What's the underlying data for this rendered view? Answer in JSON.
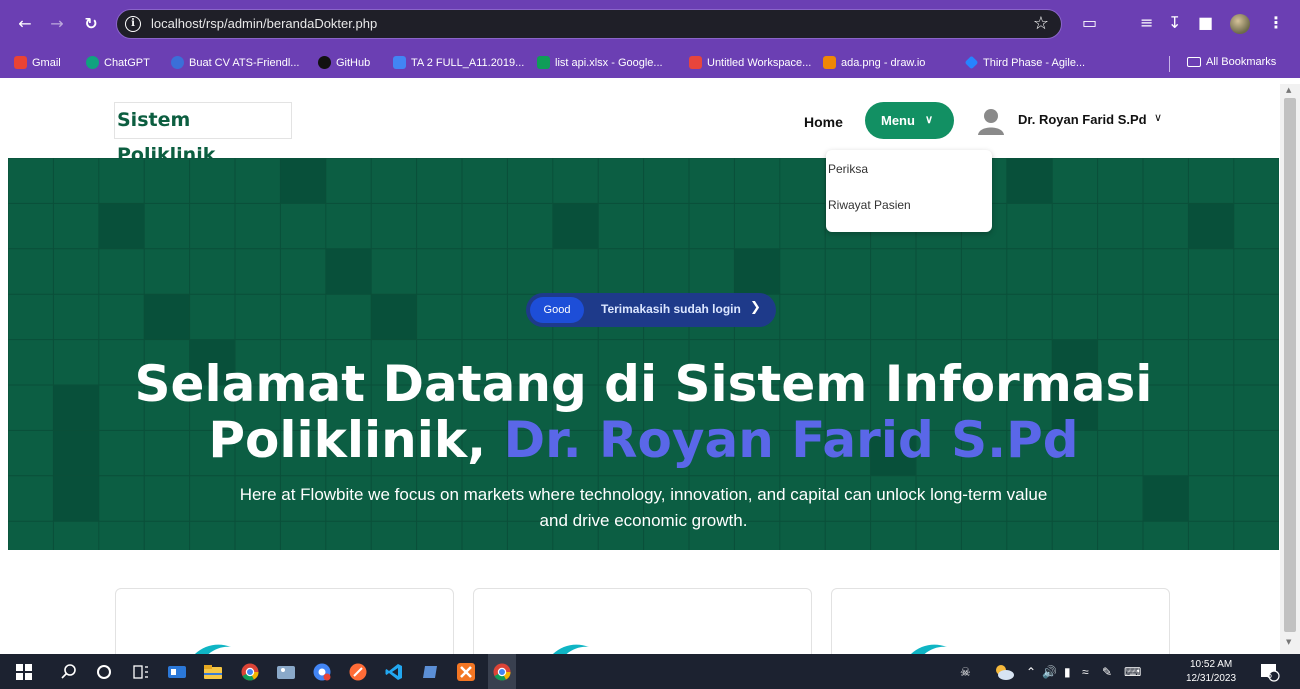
{
  "browser": {
    "url": "localhost/rsp/admin/berandaDokter.php",
    "bookmarks": [
      {
        "label": "Gmail",
        "icon": "gmail-icon",
        "color": "#ea4335"
      },
      {
        "label": "ChatGPT",
        "icon": "chatgpt-icon",
        "color": "#10a37f"
      },
      {
        "label": "Buat CV ATS-Friendl...",
        "icon": "globe-icon",
        "color": "#3b6fd8"
      },
      {
        "label": "GitHub",
        "icon": "github-icon",
        "color": "#111111"
      },
      {
        "label": "TA 2 FULL_A11.2019...",
        "icon": "docs-icon",
        "color": "#4285f4"
      },
      {
        "label": "list api.xlsx - Google...",
        "icon": "sheets-icon",
        "color": "#0f9d58"
      },
      {
        "label": "Untitled Workspace...",
        "icon": "workspace-icon",
        "color": "#e8453c"
      },
      {
        "label": "ada.png - draw.io",
        "icon": "drawio-icon",
        "color": "#f08705"
      },
      {
        "label": "Third Phase - Agile...",
        "icon": "agile-icon",
        "color": "#2684ff"
      }
    ],
    "all_bookmarks": "All Bookmarks"
  },
  "navbar": {
    "brand": "Sistem Poliklinik",
    "home": "Home",
    "menu": "Menu",
    "user_name": "Dr. Royan Farid S.Pd"
  },
  "dropdown": {
    "items": [
      "Periksa",
      "Riwayat Pasien"
    ]
  },
  "hero": {
    "badge_pill": "Good",
    "badge_text": "Terimakasih sudah login",
    "title_line1": "Selamat Datang di Sistem Informasi",
    "title_line2_prefix": "Poliklinik, ",
    "title_highlight": "Dr. Royan Farid S.Pd",
    "subtitle": "Here at Flowbite we focus on markets where technology, innovation, and capital can unlock long-term value and drive economic growth."
  },
  "colors": {
    "chrome": "#6b3fb3",
    "hero_bg": "#0c5e43",
    "brand_text": "#0c5e40",
    "menu_button": "#129063",
    "highlight": "#5a67e8",
    "badge_bg": "#1e3a8a"
  },
  "taskbar": {
    "time": "10:52 AM",
    "date": "12/31/2023",
    "notification_count": "5"
  }
}
